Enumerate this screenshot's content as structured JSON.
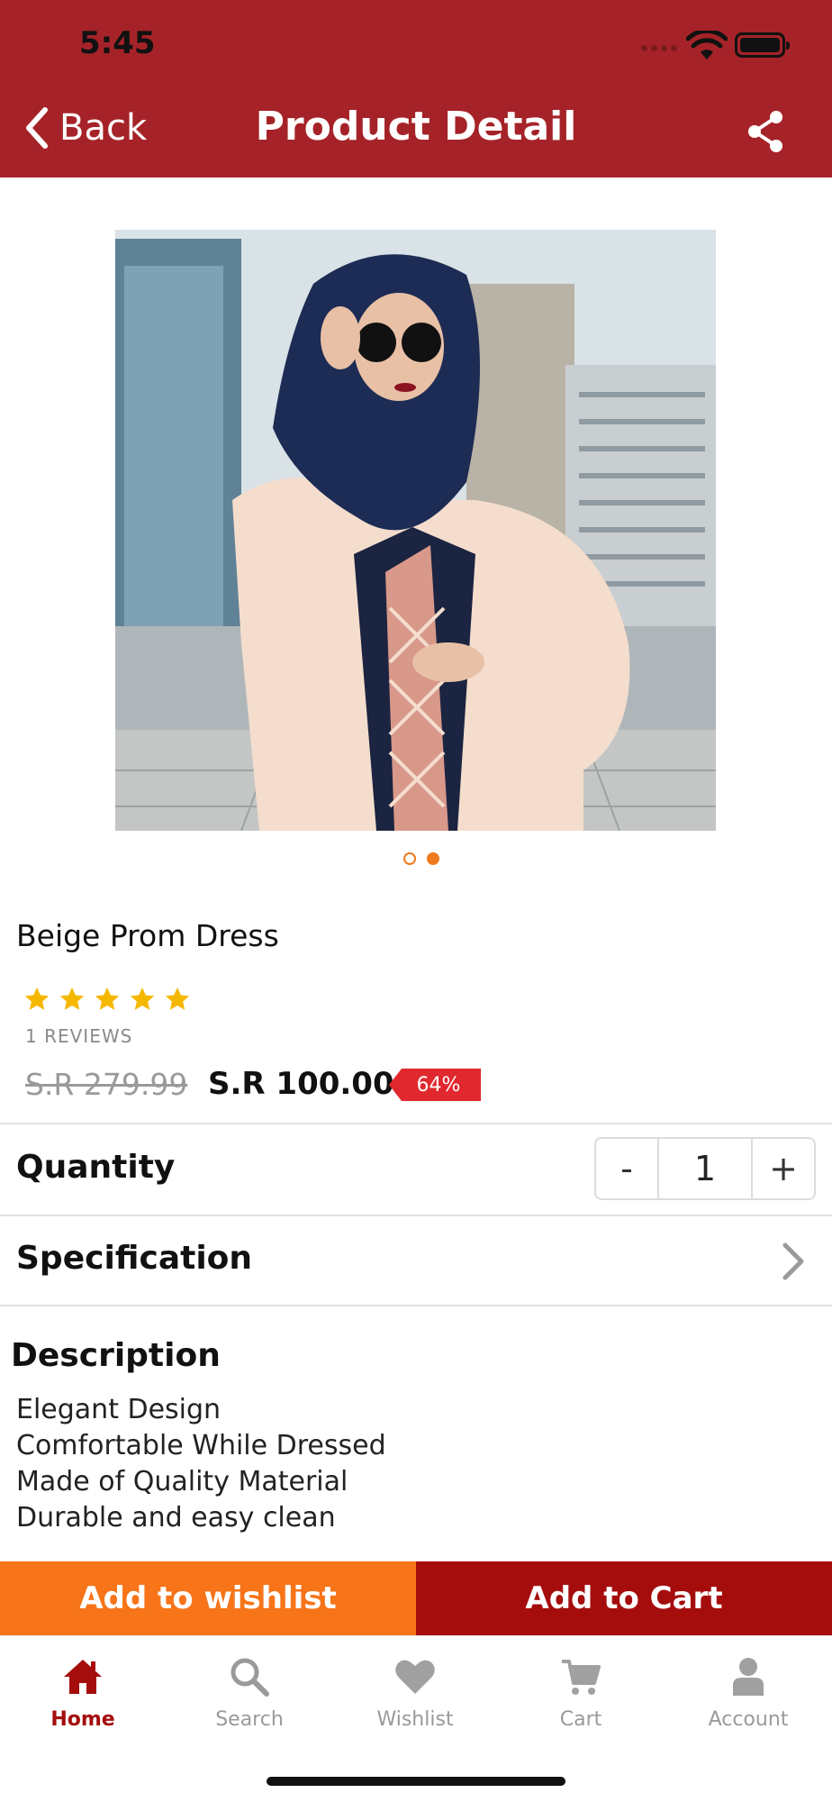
{
  "status_bar": {
    "time": "5:45"
  },
  "nav": {
    "back_label": "Back",
    "title": "Product Detail"
  },
  "product": {
    "name": "Beige Prom Dress",
    "rating": 5,
    "reviews_label": "1 REVIEWS",
    "old_price": "S.R 279.99",
    "price": "S.R 100.00",
    "discount": "64%",
    "image_count": 2,
    "active_image": 2
  },
  "quantity": {
    "label": "Quantity",
    "minus": "-",
    "value": "1",
    "plus": "+"
  },
  "specification": {
    "label": "Specification"
  },
  "description": {
    "title": "Description",
    "lines": [
      "Elegant Design",
      "Comfortable While Dressed",
      "Made of Quality Material",
      "Durable and easy clean"
    ]
  },
  "actions": {
    "wishlist": "Add to wishlist",
    "cart": "Add to Cart"
  },
  "tabs": [
    {
      "label": "Home",
      "icon": "home-icon",
      "active": true
    },
    {
      "label": "Search",
      "icon": "search-icon",
      "active": false
    },
    {
      "label": "Wishlist",
      "icon": "heart-icon",
      "active": false
    },
    {
      "label": "Cart",
      "icon": "cart-icon",
      "active": false
    },
    {
      "label": "Account",
      "icon": "person-icon",
      "active": false
    }
  ],
  "colors": {
    "header": "#a52328",
    "wishlist_button": "#f77418",
    "cart_button": "#a50d0d",
    "discount_badge": "#e0282e",
    "star": "#f5b800",
    "active_tab": "#a50d0d"
  }
}
